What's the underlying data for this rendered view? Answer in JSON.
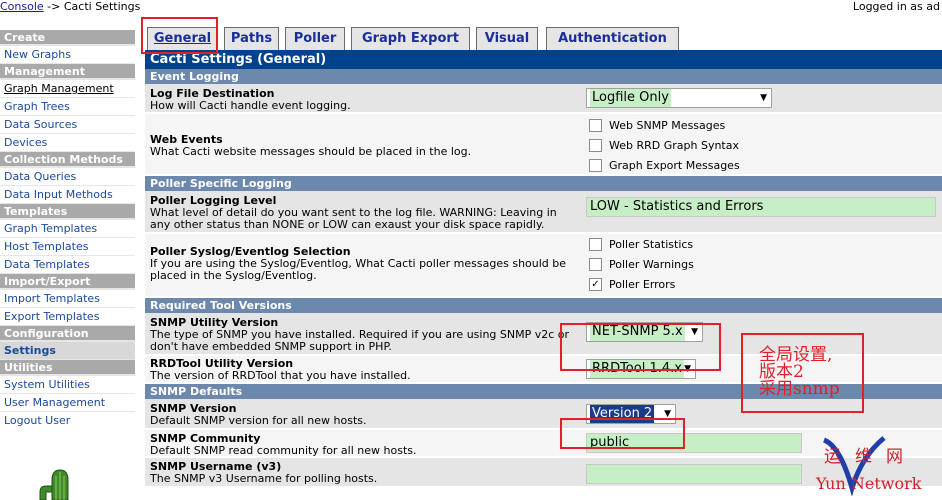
{
  "breadcrumb": {
    "console": "Console",
    "separator": " -> ",
    "current": "Cacti Settings"
  },
  "login_status": "Logged in as ad",
  "sidebar": {
    "sections": [
      {
        "header": "Create",
        "items": [
          "New Graphs"
        ]
      },
      {
        "header": "Management",
        "items": [
          "Graph Management",
          "Graph Trees",
          "Data Sources",
          "Devices"
        ]
      },
      {
        "header": "Collection Methods",
        "items": [
          "Data Queries",
          "Data Input Methods"
        ]
      },
      {
        "header": "Templates",
        "items": [
          "Graph Templates",
          "Host Templates",
          "Data Templates"
        ]
      },
      {
        "header": "Import/Export",
        "items": [
          "Import Templates",
          "Export Templates"
        ]
      },
      {
        "header": "Configuration",
        "items": [
          "Settings"
        ]
      },
      {
        "header": "Utilities",
        "items": [
          "System Utilities",
          "User Management",
          "Logout User"
        ]
      }
    ]
  },
  "tabs": [
    "General",
    "Paths",
    "Poller",
    "Graph Export",
    "Visual",
    "Authentication"
  ],
  "panel_title": "Cacti Settings (General)",
  "sections": {
    "event_logging": "Event Logging",
    "poller_logging": "Poller Specific Logging",
    "tool_versions": "Required Tool Versions",
    "snmp_defaults": "SNMP Defaults"
  },
  "fields": {
    "log_file": {
      "title": "Log File Destination",
      "desc": "How will Cacti handle event logging.",
      "value": "Logfile Only"
    },
    "web_events": {
      "title": "Web Events",
      "desc": "What Cacti website messages should be placed in the log.",
      "options": [
        {
          "label": "Web SNMP Messages",
          "checked": ""
        },
        {
          "label": "Web RRD Graph Syntax",
          "checked": ""
        },
        {
          "label": "Graph Export Messages",
          "checked": ""
        }
      ]
    },
    "poller_level": {
      "title": "Poller Logging Level",
      "desc": "What level of detail do you want sent to the log file. WARNING: Leaving in any other status than NONE or LOW can exaust your disk space rapidly.",
      "value": "LOW - Statistics and Errors"
    },
    "poller_syslog": {
      "title": "Poller Syslog/Eventlog Selection",
      "desc": "If you are using the Syslog/Eventlog, What Cacti poller messages should be placed in the Syslog/Eventlog.",
      "options": [
        {
          "label": "Poller Statistics",
          "checked": ""
        },
        {
          "label": "Poller Warnings",
          "checked": ""
        },
        {
          "label": "Poller Errors",
          "checked": "✓"
        }
      ]
    },
    "snmp_utility": {
      "title": "SNMP Utility Version",
      "desc": "The type of SNMP you have installed. Required if you are using SNMP v2c or don't have embedded SNMP support in PHP.",
      "value": "NET-SNMP 5.x"
    },
    "rrdtool": {
      "title": "RRDTool Utility Version",
      "desc": "The version of RRDTool that you have installed.",
      "value": "RRDTool 1.4.x"
    },
    "snmp_version": {
      "title": "SNMP Version",
      "desc": "Default SNMP version for all new hosts.",
      "value": "Version 2"
    },
    "snmp_community": {
      "title": "SNMP Community",
      "desc": "Default SNMP read community for all new hosts.",
      "value": "public"
    },
    "snmp_username": {
      "title": "SNMP Username (v3)",
      "desc": "The SNMP v3 Username for polling hosts."
    }
  },
  "annotation": {
    "line1": "全局设置,",
    "line2": "版本2",
    "line3": "采用snmp"
  },
  "watermark": {
    "line1": "运维网",
    "line2": "Yun Network"
  },
  "colors": {
    "header": "#00438c",
    "section": "#6d88ad",
    "highlight": "#e0202a",
    "field_bg": "#c6efc6"
  }
}
